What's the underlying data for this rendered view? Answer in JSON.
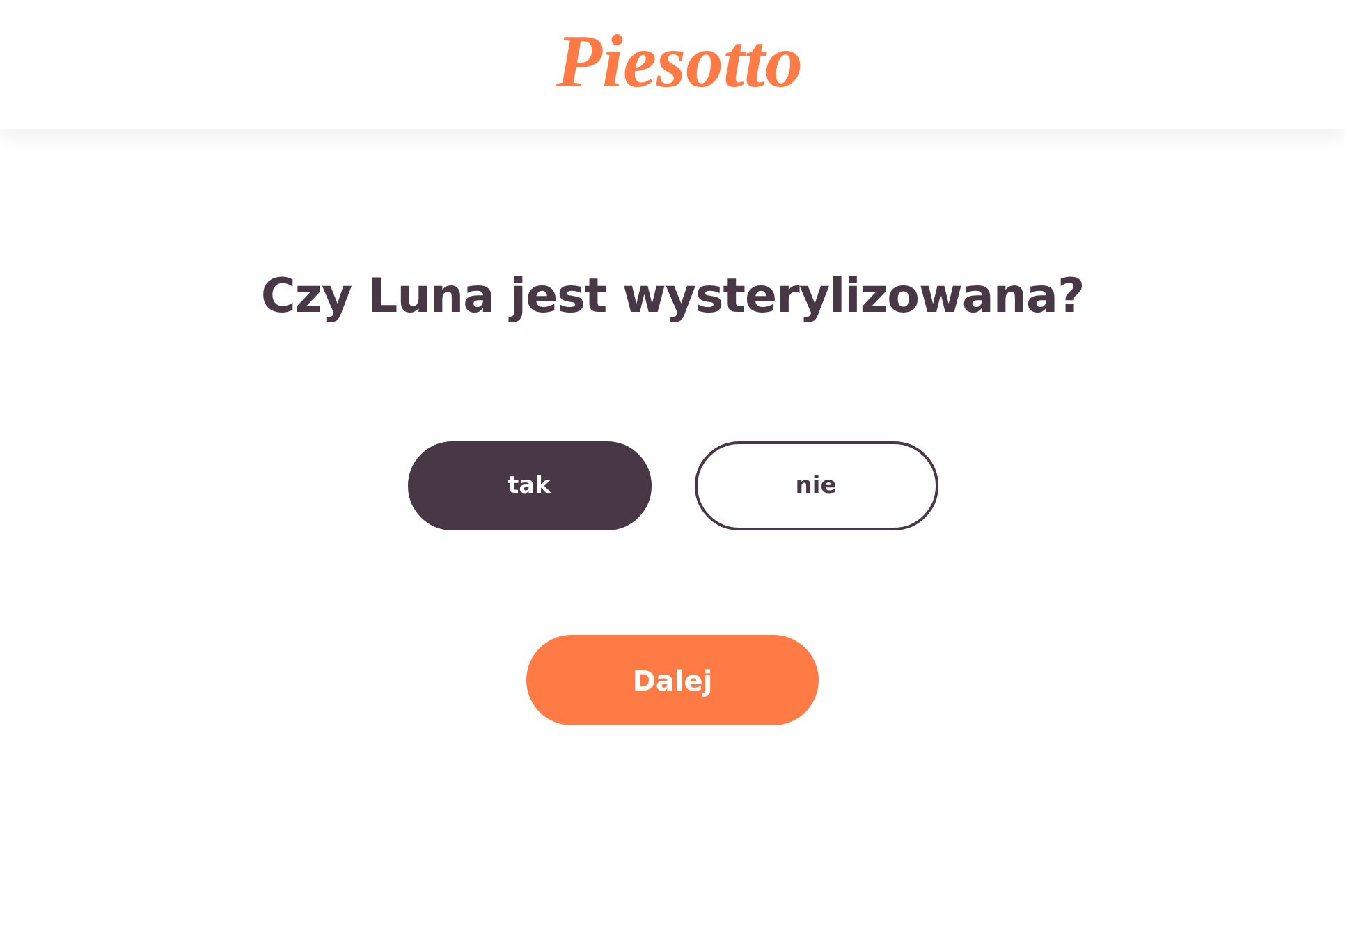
{
  "header": {
    "logo": "Piesotto"
  },
  "question": "Czy Luna jest wysterylizowana?",
  "options": [
    {
      "label": "tak",
      "selected": true
    },
    {
      "label": "nie",
      "selected": false
    }
  ],
  "next_button": {
    "label": "Dalej"
  }
}
